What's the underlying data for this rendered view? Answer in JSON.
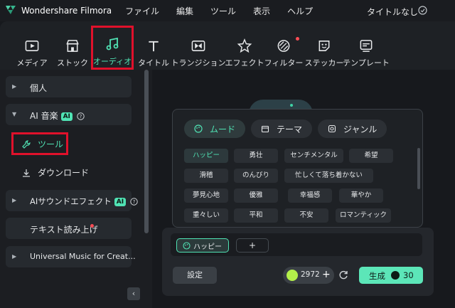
{
  "app": {
    "title": "Wondershare Filmora",
    "project_title": "タイトルなし"
  },
  "menu": [
    "ファイル",
    "編集",
    "ツール",
    "表示",
    "ヘルプ"
  ],
  "toolbar": {
    "items": [
      {
        "label": "メディア",
        "icon": "media-icon"
      },
      {
        "label": "ストック",
        "icon": "stock-icon"
      },
      {
        "label": "オーディオ",
        "icon": "audio-icon",
        "active": true
      },
      {
        "label": "タイトル",
        "icon": "title-icon"
      },
      {
        "label": "トランジション",
        "icon": "transition-icon"
      },
      {
        "label": "エフェクト",
        "icon": "effect-icon"
      },
      {
        "label": "フィルター",
        "icon": "filter-icon",
        "notify": true
      },
      {
        "label": "ステッカー",
        "icon": "sticker-icon"
      },
      {
        "label": "テンプレート",
        "icon": "template-icon"
      }
    ]
  },
  "sidebar": {
    "personal": "個人",
    "ai_music": "AI 音楽",
    "ai_badge": "AI",
    "tool": "ツール",
    "download": "ダウンロード",
    "ai_sound": "AIサウンドエフェクト",
    "tts": "テキスト読み上げ",
    "universal": "Universal Music for Creat..."
  },
  "popup": {
    "tabs": [
      "ムード",
      "テーマ",
      "ジャンル"
    ],
    "chips": [
      [
        "ハッピー",
        "勇壮",
        "センチメンタル",
        "希望"
      ],
      [
        "滑稽",
        "のんびり",
        "忙しくて落ち着かない"
      ],
      [
        "夢見心地",
        "優雅",
        "幸福感",
        "華やか"
      ],
      [
        "重々しい",
        "平和",
        "不安",
        "ロマンティック"
      ]
    ]
  },
  "panel": {
    "selected_tag": "ハッピー",
    "add_label": "+",
    "settings_label": "設定",
    "credits": "2972",
    "credits_plus": "+",
    "generate_label": "生成",
    "generate_cost": "30"
  },
  "colors": {
    "accent": "#50e3b4",
    "highlight": "#e0112b",
    "button": "#5ce6b8"
  }
}
